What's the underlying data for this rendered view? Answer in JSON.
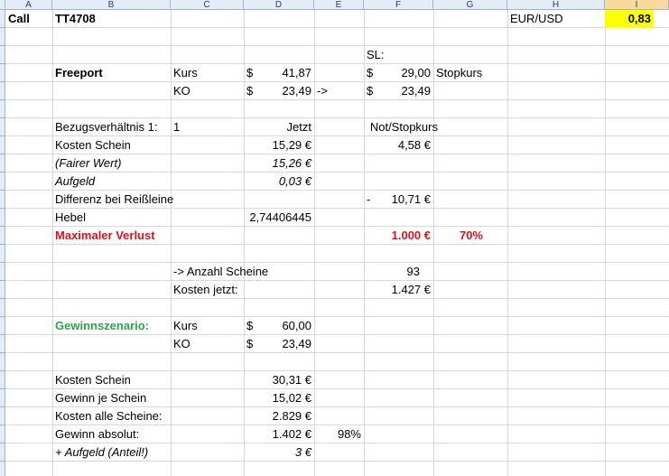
{
  "columns": [
    "A",
    "B",
    "C",
    "D",
    "E",
    "F",
    "G",
    "H",
    "I"
  ],
  "colors": {
    "red": "#e0101e",
    "green": "#2ea44a",
    "highlight": "#ffff00",
    "header_bg": "#e4ecf7",
    "selected_header": "#f9d99f"
  },
  "r1": {
    "a": "Call",
    "b": "TT4708",
    "h": "EUR/USD",
    "i": "0,83"
  },
  "r3": {
    "f_label": "SL:"
  },
  "r4": {
    "b": "Freeport",
    "c": "Kurs",
    "d_cur": "$",
    "d_val": "41,87",
    "f_cur": "$",
    "f_val": "29,00",
    "g": "Stopkurs"
  },
  "r5": {
    "c": "KO",
    "d_cur": "$",
    "d_val": "23,49",
    "e": "->",
    "f_cur": "$",
    "f_val": "23,49"
  },
  "r7": {
    "b": "Bezugsverhältnis 1:",
    "c": "1",
    "d": "Jetzt",
    "f": "Not/Stopkurs"
  },
  "r8": {
    "b": "Kosten Schein",
    "d": "15,29 €",
    "f": "4,58 €"
  },
  "r9": {
    "b": "(Fairer Wert)",
    "d": "15,26 €"
  },
  "r10": {
    "b": "Aufgeld",
    "d": "0,03 €"
  },
  "r11": {
    "b": "Differenz bei Reißleine",
    "f_dash": "-",
    "f": "10,71 €"
  },
  "r12": {
    "b": "Hebel",
    "d": "2,74406445"
  },
  "r13": {
    "b": "Maximaler Verlust",
    "f": "1.000 €",
    "g": "70%"
  },
  "r15": {
    "c": "-> Anzahl Scheine",
    "f": "93"
  },
  "r16": {
    "c": "Kosten jetzt:",
    "f": "1.427 €"
  },
  "r18": {
    "b": "Gewinnszenario:",
    "c": "Kurs",
    "d_cur": "$",
    "d_val": "60,00"
  },
  "r19": {
    "c": "KO",
    "d_cur": "$",
    "d_val": "23,49"
  },
  "r21": {
    "b": "Kosten Schein",
    "d": "30,31 €"
  },
  "r22": {
    "b": "Gewinn je Schein",
    "d": "15,02 €"
  },
  "r23": {
    "b": "Kosten alle Scheine:",
    "d": "2.829 €"
  },
  "r24": {
    "b": "Gewinn absolut:",
    "d": "1.402 €",
    "e": "98%"
  },
  "r25": {
    "b": "+ Aufgeld (Anteil!)",
    "d": "3 €"
  }
}
